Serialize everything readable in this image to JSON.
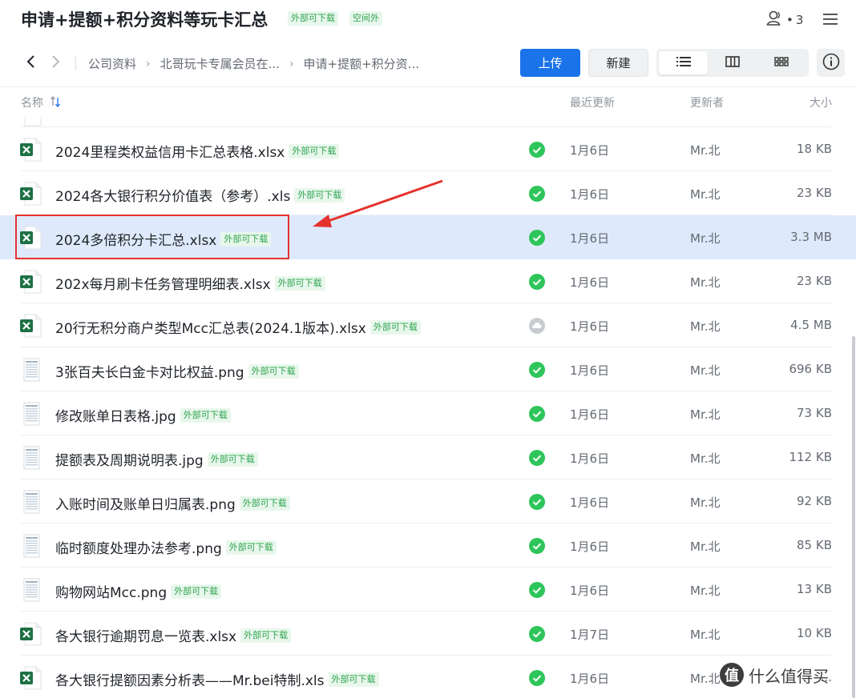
{
  "header": {
    "title": "申请+提额+积分资料等玩卡汇总",
    "tags": [
      "外部可下载",
      "空间外"
    ],
    "member_count": "3"
  },
  "toolbar": {
    "breadcrumb": [
      "公司资料",
      "北哥玩卡专属会员在...",
      "申请+提额+积分资..."
    ],
    "upload_label": "上传",
    "new_label": "新建"
  },
  "table": {
    "columns": {
      "name": "名称",
      "date": "最近更新",
      "updater": "更新者",
      "size": "大小"
    },
    "tag_label": "外部可下载",
    "rows": [
      {
        "name": "2024里程类权益信用卡汇总表格.xlsx",
        "status": "synced",
        "date": "1月6日",
        "updater": "Mr.北",
        "size": "18 KB",
        "icon": "excel-icon"
      },
      {
        "name": "2024各大银行积分价值表（参考）.xls",
        "status": "synced",
        "date": "1月6日",
        "updater": "Mr.北",
        "size": "23 KB",
        "icon": "excel-icon"
      },
      {
        "name": "2024多倍积分卡汇总.xlsx",
        "status": "synced",
        "date": "1月6日",
        "updater": "Mr.北",
        "size": "3.3 MB",
        "icon": "excel-icon",
        "selected": true
      },
      {
        "name": "202x每月刷卡任务管理明细表.xlsx",
        "status": "synced",
        "date": "1月6日",
        "updater": "Mr.北",
        "size": "23 KB",
        "icon": "excel-icon"
      },
      {
        "name": "20行无积分商户类型Mcc汇总表(2024.1版本).xlsx",
        "status": "cloud",
        "date": "1月6日",
        "updater": "Mr.北",
        "size": "4.5 MB",
        "icon": "excel-icon"
      },
      {
        "name": "3张百夫长白金卡对比权益.png",
        "status": "synced",
        "date": "1月6日",
        "updater": "Mr.北",
        "size": "696 KB",
        "icon": "image-thumbnail-icon"
      },
      {
        "name": "修改账单日表格.jpg",
        "status": "synced",
        "date": "1月6日",
        "updater": "Mr.北",
        "size": "73 KB",
        "icon": "image-thumbnail-icon"
      },
      {
        "name": "提额表及周期说明表.jpg",
        "status": "synced",
        "date": "1月6日",
        "updater": "Mr.北",
        "size": "112 KB",
        "icon": "image-thumbnail-icon"
      },
      {
        "name": "入账时间及账单日归属表.png",
        "status": "synced",
        "date": "1月6日",
        "updater": "Mr.北",
        "size": "92 KB",
        "icon": "image-thumbnail-icon"
      },
      {
        "name": "临时额度处理办法参考.png",
        "status": "synced",
        "date": "1月6日",
        "updater": "Mr.北",
        "size": "85 KB",
        "icon": "image-thumbnail-icon"
      },
      {
        "name": "购物网站Mcc.png",
        "status": "synced",
        "date": "1月6日",
        "updater": "Mr.北",
        "size": "13 KB",
        "icon": "image-thumbnail-icon"
      },
      {
        "name": "各大银行逾期罚息一览表.xlsx",
        "status": "synced",
        "date": "1月7日",
        "updater": "Mr.北",
        "size": "10 KB",
        "icon": "excel-icon"
      },
      {
        "name": "各大银行提额因素分析表——Mr.bei特制.xls",
        "status": "synced",
        "date": "1月6日",
        "updater": "Mr.北",
        "size": "...",
        "icon": "excel-icon"
      }
    ]
  },
  "watermark": {
    "badge": "值",
    "text": "什么值得买"
  },
  "colors": {
    "accent": "#1a73e8",
    "selected_row": "#deeafb",
    "tag_bg": "#e8f7ec",
    "tag_fg": "#2ea44f",
    "status_ok": "#2ec55b",
    "annotation_red": "#e5322d",
    "excel_green": "#1e7145"
  }
}
